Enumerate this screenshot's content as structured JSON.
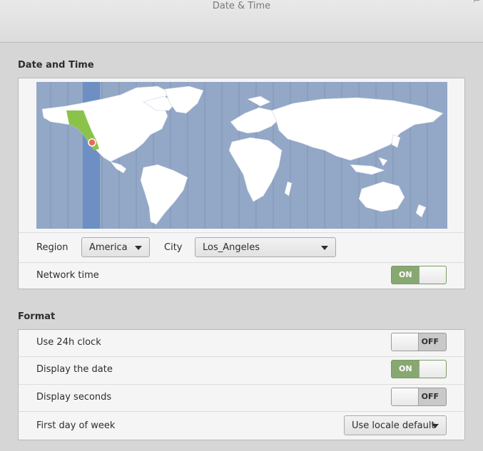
{
  "window": {
    "title": "Date & Time",
    "corner_glyph": "⌐"
  },
  "date_time": {
    "section_title": "Date and Time",
    "map": {
      "highlight_region": "America/Los_Angeles",
      "marker_color": "#e86a5a",
      "zone_color": "#6d8fc4",
      "land_color": "#ffffff",
      "sea_color": "#93a7c7",
      "selected_land_color": "#8bc34a"
    },
    "region": {
      "label": "Region",
      "value": "America"
    },
    "city": {
      "label": "City",
      "value": "Los_Angeles"
    },
    "network_time": {
      "label": "Network time",
      "state": "ON"
    }
  },
  "format": {
    "section_title": "Format",
    "use_24h": {
      "label": "Use 24h clock",
      "state": "OFF"
    },
    "display_date": {
      "label": "Display the date",
      "state": "ON"
    },
    "display_seconds": {
      "label": "Display seconds",
      "state": "OFF"
    },
    "first_day": {
      "label": "First day of week",
      "value": "Use locale default"
    }
  },
  "colors": {
    "switch_on": "#88a871",
    "switch_off": "#c9c9c9"
  }
}
